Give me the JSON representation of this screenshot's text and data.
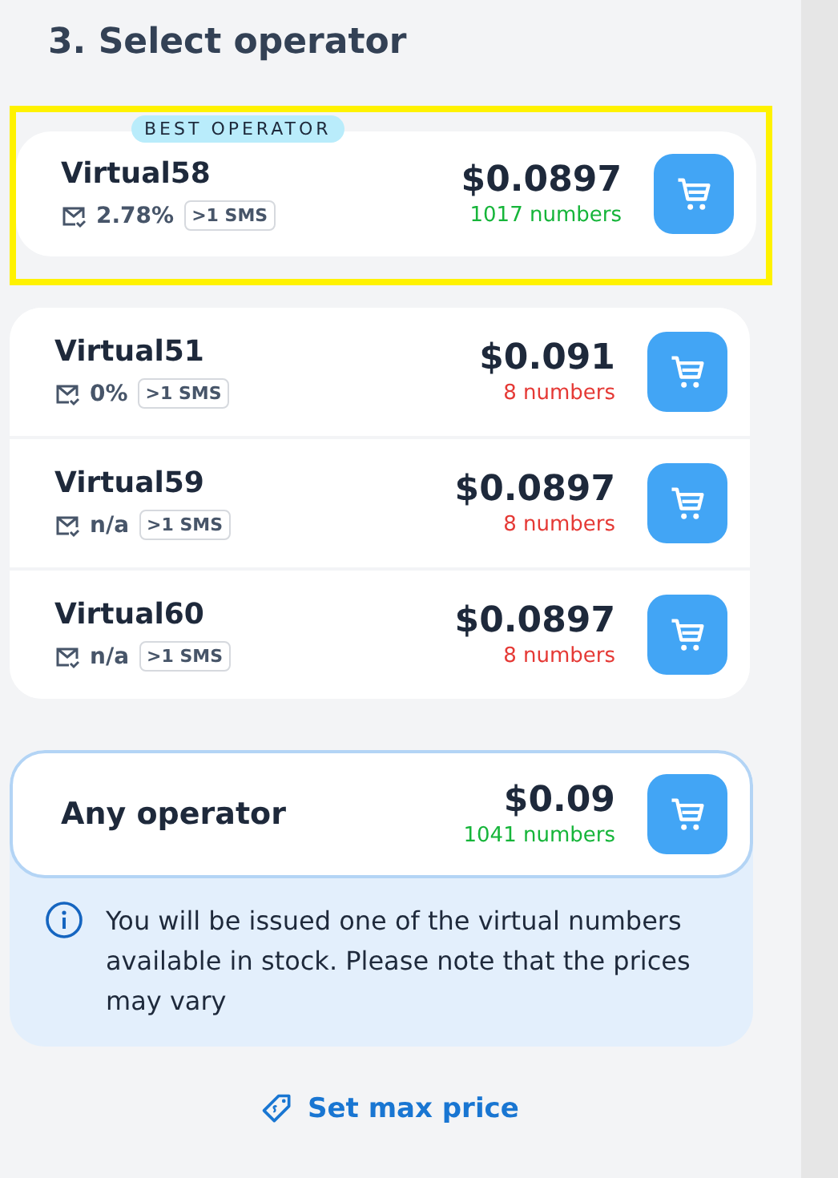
{
  "title": "3. Select operator",
  "best": {
    "badge": "BEST OPERATOR",
    "highlighted": true,
    "name": "Virtual58",
    "rate": "2.78%",
    "tag": ">1 SMS",
    "price": "$0.0897",
    "stock": "1017 numbers",
    "low_stock": false
  },
  "operators": [
    {
      "name": "Virtual51",
      "rate": "0%",
      "tag": ">1 SMS",
      "price": "$0.091",
      "stock": "8 numbers",
      "low_stock": true
    },
    {
      "name": "Virtual59",
      "rate": "n/a",
      "tag": ">1 SMS",
      "price": "$0.0897",
      "stock": "8 numbers",
      "low_stock": true
    },
    {
      "name": "Virtual60",
      "rate": "n/a",
      "tag": ">1 SMS",
      "price": "$0.0897",
      "stock": "8 numbers",
      "low_stock": true
    }
  ],
  "any": {
    "name": "Any operator",
    "price": "$0.09",
    "stock": "1041 numbers",
    "low_stock": false,
    "info": "You will be issued one of the virtual numbers available in stock. Please note that the prices may vary"
  },
  "max_price_link": "Set max price"
}
